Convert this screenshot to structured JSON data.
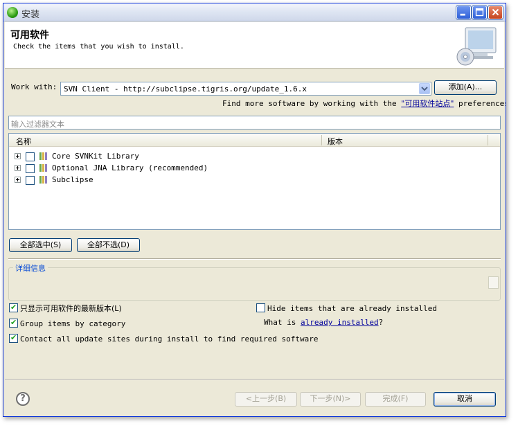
{
  "window": {
    "title": "安装"
  },
  "header": {
    "title": "可用软件",
    "description": "Check the items that you wish to install."
  },
  "work_with": {
    "label": "Work with:",
    "value": "SVN Client - http://subclipse.tigris.org/update_1.6.x",
    "add_button": "添加(A)..."
  },
  "find_more": {
    "prefix": "Find more software by working with the",
    "link": "\"可用软件站点\"",
    "suffix": "preferences."
  },
  "filter": {
    "placeholder": "输入过滤器文本"
  },
  "table": {
    "columns": [
      "名称",
      "版本"
    ],
    "rows": [
      {
        "label": "Core SVNKit Library",
        "checked": false
      },
      {
        "label": "Optional JNA Library (recommended)",
        "checked": false
      },
      {
        "label": "Subclipse",
        "checked": false
      }
    ]
  },
  "selection_buttons": {
    "select_all": "全部选中(S)",
    "deselect_all": "全部不选(D)"
  },
  "details": {
    "title": "详细信息"
  },
  "options": {
    "show_latest": {
      "label": "只显示可用软件的最新版本(L)",
      "checked": true
    },
    "group_by_category": {
      "label": "Group items by category",
      "checked": true
    },
    "contact_all_sites": {
      "label": "Contact all update sites during install to find required software",
      "checked": true
    },
    "hide_installed": {
      "label": "Hide items that are already installed",
      "checked": false
    },
    "what_is_prefix": "What is",
    "what_is_link": "already installed",
    "what_is_suffix": "?"
  },
  "footer": {
    "back": "<上一步(B)",
    "next": "下一步(N)>",
    "finish": "完成(F)",
    "cancel": "取消"
  },
  "colors": {
    "accent": "#0831d9",
    "link": "#00009c",
    "details_title": "#0046d5",
    "check": "#21a121"
  },
  "icons": {
    "app": "eclipse-install-icon",
    "header_graphic": "monitor-cd-icon",
    "help": "help-icon",
    "package": "feature-package-icon"
  }
}
